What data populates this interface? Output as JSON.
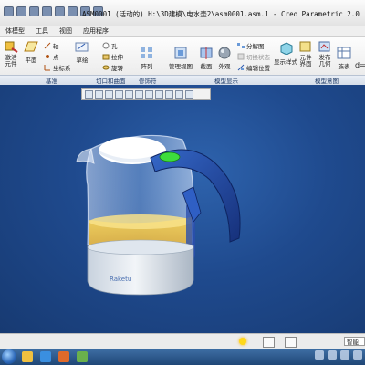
{
  "window": {
    "title": "ASM0001 (活动的) H:\\3D建模\\电水壶2\\asm0001.asm.1 - Creo Parametric 2.0"
  },
  "menu": {
    "tabs": [
      "体模型",
      "工具",
      "视图",
      "应用程序"
    ]
  },
  "ribbon": {
    "buttons": {
      "assemble": "激活\n元件",
      "plane": "平面",
      "axis": "轴",
      "point": "点",
      "csys": "坐标系",
      "sketch": "草绘",
      "hole": "孔",
      "extrude": "拉伸",
      "revolve": "旋转",
      "pattern": "阵列",
      "manage_views": "管理视图",
      "section": "截面",
      "appearance": "外观",
      "explode": "分解图",
      "toggle_status": "切换状态",
      "edit_position": "编辑位置",
      "display_style": "显示样式",
      "component_interface": "元件\n界面",
      "publish_geometry": "发布\n几何",
      "family_table": "族表",
      "relations": "d="
    },
    "groups": [
      "基准",
      "切口和曲面",
      "修饰符",
      "模型显示",
      "模型意图"
    ]
  },
  "model": {
    "brand": "Raketu"
  },
  "status": {
    "selection_filter": "智能"
  },
  "colors": {
    "accent_blue": "#1f4a8e",
    "handle_blue": "#1b3f9e",
    "button_green": "#3ddc3d",
    "water_amber": "#e8b53b"
  }
}
